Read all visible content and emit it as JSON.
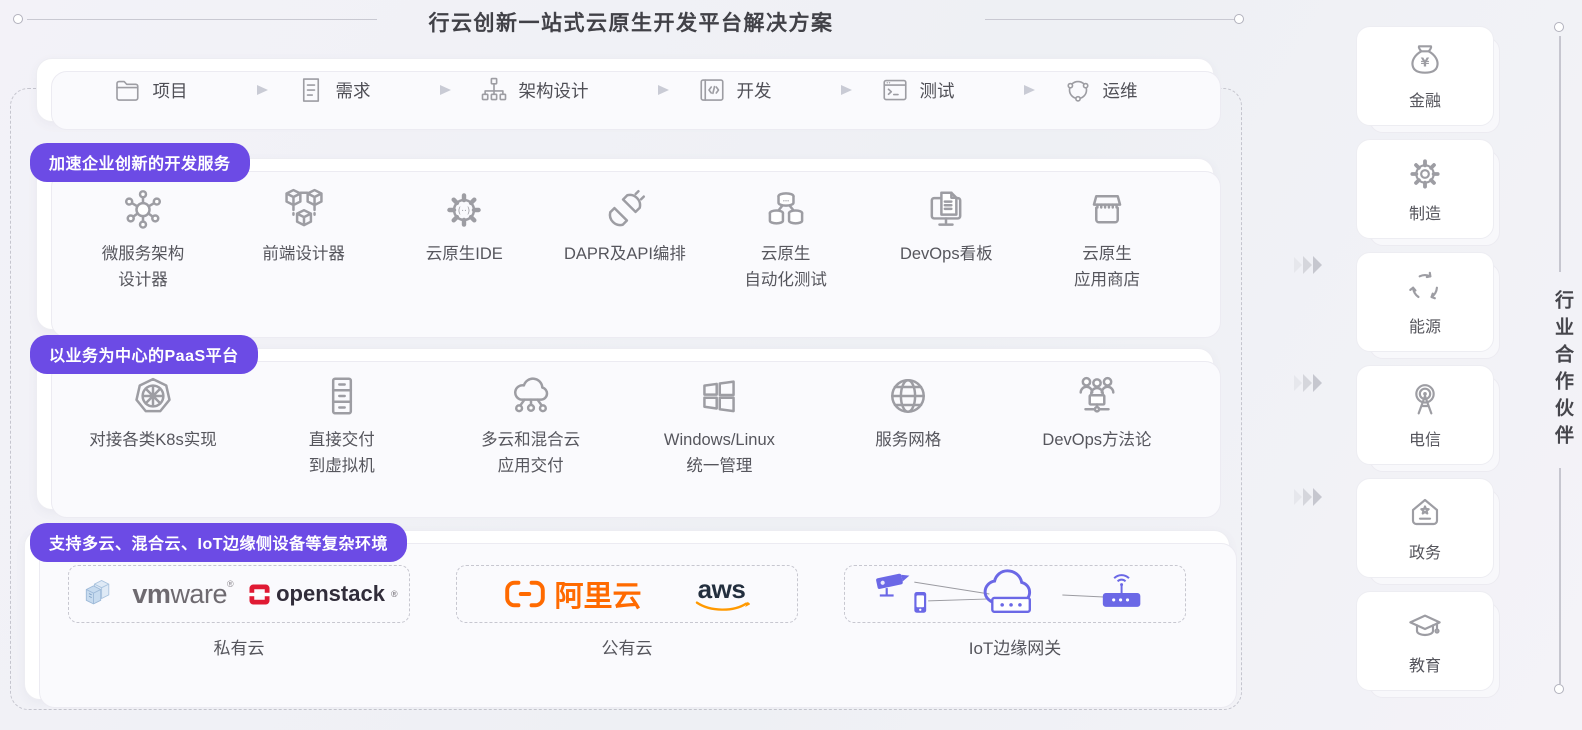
{
  "title": "行云创新一站式云原生开发平台解决方案",
  "workflow": {
    "steps": [
      {
        "label": "项目",
        "icon": "folder-icon"
      },
      {
        "label": "需求",
        "icon": "document-icon"
      },
      {
        "label": "架构设计",
        "icon": "sitemap-icon"
      },
      {
        "label": "开发",
        "icon": "code-window-icon"
      },
      {
        "label": "测试",
        "icon": "terminal-icon"
      },
      {
        "label": "运维",
        "icon": "ops-cycle-icon"
      }
    ]
  },
  "dev_services": {
    "badge": "加速企业创新的开发服务",
    "items": [
      {
        "line1": "微服务架构",
        "line2": "设计器",
        "icon": "microservice-icon"
      },
      {
        "line1": "前端设计器",
        "icon": "cubes-icon"
      },
      {
        "line1": "云原生IDE",
        "icon": "gear-code-icon"
      },
      {
        "line1": "DAPR及API编排",
        "icon": "plug-icon"
      },
      {
        "line1": "云原生",
        "line2": "自动化测试",
        "icon": "database-cluster-icon"
      },
      {
        "line1": "DevOps看板",
        "icon": "monitor-doc-icon"
      },
      {
        "line1": "云原生",
        "line2": "应用商店",
        "icon": "storefront-icon"
      }
    ]
  },
  "paas": {
    "badge": "以业务为中心的PaaS平台",
    "items": [
      {
        "line1": "对接各类K8s实现",
        "icon": "kubernetes-icon"
      },
      {
        "line1": "直接交付",
        "line2": "到虚拟机",
        "icon": "server-rack-icon"
      },
      {
        "line1": "多云和混合云",
        "line2": "应用交付",
        "icon": "cloud-network-icon"
      },
      {
        "line1": "Windows/Linux",
        "line2": "统一管理",
        "icon": "windows-icon"
      },
      {
        "line1": "服务网格",
        "icon": "globe-icon"
      },
      {
        "line1": "DevOps方法论",
        "icon": "team-board-icon"
      }
    ]
  },
  "environments": {
    "badge": "支持多云、混合云、IoT边缘侧设备等复杂环境",
    "groups": [
      {
        "label": "私有云"
      },
      {
        "label": "公有云"
      },
      {
        "label": "IoT边缘网关"
      }
    ],
    "logos": {
      "vmware_bold": "vm",
      "vmware_rest": "ware",
      "vmware_reg": "®",
      "openstack": "openstack",
      "openstack_reg": "®",
      "aliyun": "阿里云",
      "aws": "aws"
    }
  },
  "partners": {
    "vertical_label": "行业合作伙伴",
    "items": [
      {
        "label": "金融",
        "icon": "money-bag-icon"
      },
      {
        "label": "制造",
        "icon": "gear-icon"
      },
      {
        "label": "能源",
        "icon": "recycle-icon"
      },
      {
        "label": "电信",
        "icon": "antenna-tower-icon"
      },
      {
        "label": "政务",
        "icon": "government-icon"
      },
      {
        "label": "教育",
        "icon": "graduation-cap-icon"
      }
    ]
  },
  "icon_glyphs": {
    "yen": "¥",
    "ide_dots": "(··)"
  },
  "colors": {
    "badge_purple": "#6C4BE5",
    "iot_purple": "#6B68E6",
    "aliyun_orange": "#FF6A00",
    "aws_orange": "#FF9900",
    "aws_dark": "#232F3E",
    "openstack_red": "#E01A33",
    "vmware_gray": "#6E6A70",
    "icon_gray": "#9d9da3"
  }
}
